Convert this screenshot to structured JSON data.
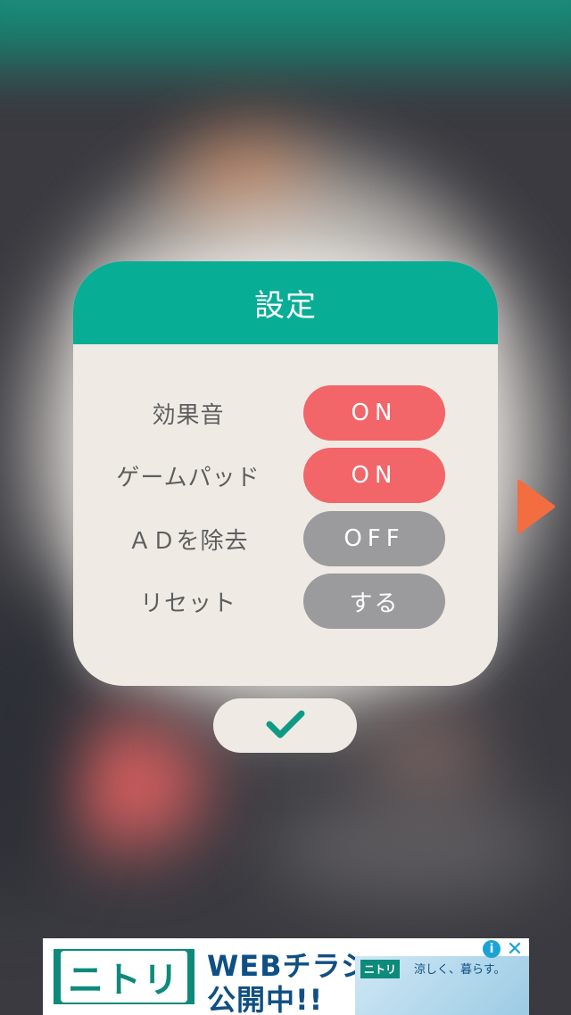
{
  "dialog": {
    "title": "設定",
    "rows": [
      {
        "label": "効果音",
        "value": "ON",
        "state": "on"
      },
      {
        "label": "ゲームパッド",
        "value": "ON",
        "state": "on"
      },
      {
        "label": "ＡＤを除去",
        "value": "OFF",
        "state": "off"
      },
      {
        "label": "リセット",
        "value": "する",
        "state": "action"
      }
    ]
  },
  "icons": {
    "confirm": "checkmark-icon",
    "next": "play-arrow-icon",
    "ad_info": "info-icon",
    "ad_close": "close-icon"
  },
  "ad": {
    "brand": "ニトリ",
    "headline_line1": "WEBチラシ",
    "headline_line2": "公開中!!",
    "promo_brand": "ニトリ",
    "promo_text": "涼しく、暮らす。",
    "info_glyph": "i",
    "close_glyph": "✕"
  },
  "colors": {
    "header": "#08ad96",
    "panel": "#efebe4",
    "toggle_on": "#f26569",
    "toggle_off": "#9b9b9d",
    "check": "#0e9a85",
    "arrow": "#f26d40"
  }
}
